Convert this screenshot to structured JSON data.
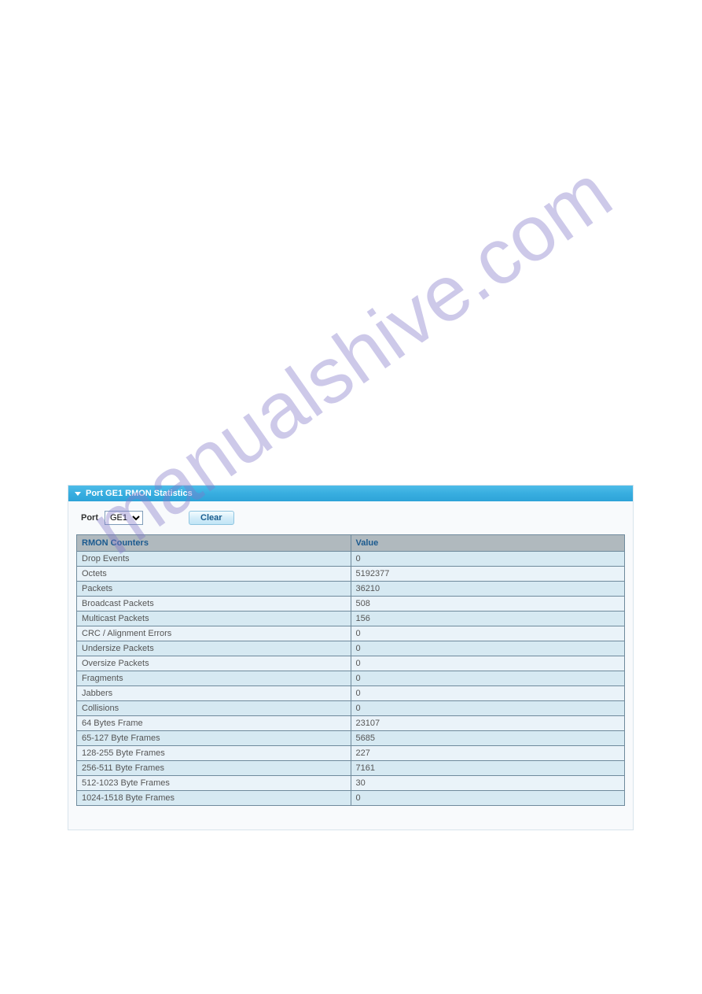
{
  "watermark_text": "manualshive.com",
  "panel": {
    "title": "Port GE1 RMON Statistics",
    "port_label": "Port",
    "port_selected": "GE1",
    "clear_label": "Clear"
  },
  "table": {
    "header_counter": "RMON Counters",
    "header_value": "Value",
    "rows": [
      {
        "name": "Drop Events",
        "value": "0"
      },
      {
        "name": "Octets",
        "value": "5192377"
      },
      {
        "name": "Packets",
        "value": "36210"
      },
      {
        "name": "Broadcast Packets",
        "value": "508"
      },
      {
        "name": "Multicast Packets",
        "value": "156"
      },
      {
        "name": "CRC / Alignment Errors",
        "value": "0"
      },
      {
        "name": "Undersize Packets",
        "value": "0"
      },
      {
        "name": "Oversize Packets",
        "value": "0"
      },
      {
        "name": "Fragments",
        "value": "0"
      },
      {
        "name": "Jabbers",
        "value": "0"
      },
      {
        "name": "Collisions",
        "value": "0"
      },
      {
        "name": "64 Bytes Frame",
        "value": "23107"
      },
      {
        "name": "65-127 Byte Frames",
        "value": "5685"
      },
      {
        "name": "128-255 Byte Frames",
        "value": "227"
      },
      {
        "name": "256-511 Byte Frames",
        "value": "7161"
      },
      {
        "name": "512-1023 Byte Frames",
        "value": "30"
      },
      {
        "name": "1024-1518 Byte Frames",
        "value": "0"
      }
    ]
  }
}
